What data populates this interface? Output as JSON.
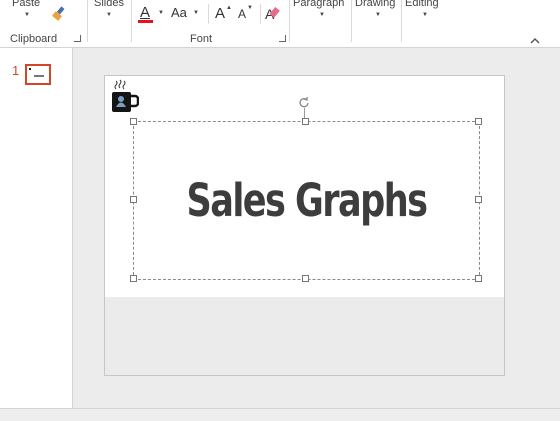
{
  "ribbon": {
    "paste_label": "Paste",
    "slides_label": "Slides",
    "font_color_glyph": "A",
    "change_case_label": "Aa",
    "grow_font_glyph": "A",
    "shrink_font_glyph": "A",
    "paragraph_label": "Paragraph",
    "drawing_label": "Drawing",
    "editing_label": "Editing",
    "groups": {
      "clipboard": "Clipboard",
      "font": "Font"
    },
    "font_color": "#e81123"
  },
  "thumbnails": {
    "items": [
      {
        "number": "1"
      }
    ]
  },
  "slide": {
    "title": "Sales Graphs"
  },
  "colors": {
    "accent": "#d24726"
  }
}
